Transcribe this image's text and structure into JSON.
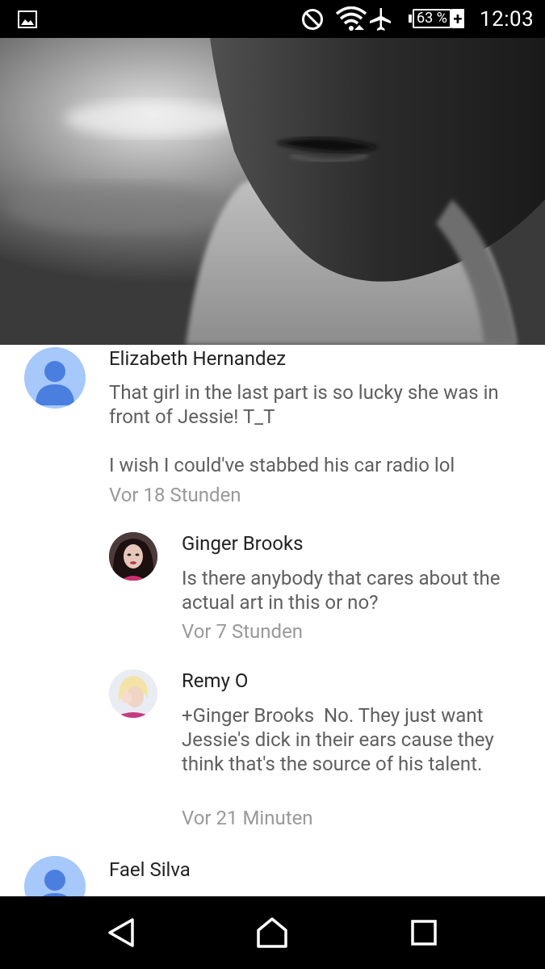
{
  "status_bar": {
    "time": "12:03",
    "battery_percent": "63 %",
    "battery_plus": "+",
    "icons": [
      "gallery-notification-icon",
      "do-not-disturb-icon",
      "wifi-icon",
      "airplane-mode-icon",
      "battery-icon"
    ]
  },
  "video": {
    "description_icon": "video-player"
  },
  "comments": [
    {
      "author": "Elizabeth Hernandez",
      "text": "That girl in the last part is so lucky she was in front of Jessie! T_T\n\nI wish I could've stabbed his car radio lol",
      "time": "Vor 18 Stunden"
    },
    {
      "author": "Ginger Brooks",
      "text": "Is there anybody that cares about the actual art in this or no?",
      "time": "Vor 7 Stunden"
    },
    {
      "author": "Remy O",
      "text": "+Ginger Brooks  No. They just want Jessie's dick in their ears cause they think that's the source of his talent.",
      "time": "Vor 21 Minuten"
    },
    {
      "author": "Fael Silva",
      "text": "",
      "time": ""
    }
  ],
  "nav_bar": {
    "buttons": [
      "back",
      "home",
      "recents"
    ]
  },
  "colors": {
    "avatar_placeholder": "#a6c8fb",
    "avatar_glyph": "#4a7fe0",
    "author_text": "#222222",
    "body_text": "#5e5e5e",
    "timestamp_text": "#999999"
  }
}
